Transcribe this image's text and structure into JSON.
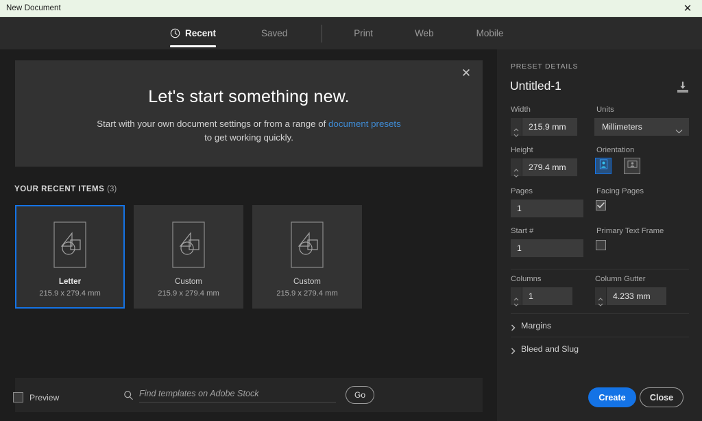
{
  "titlebar": {
    "title": "New Document",
    "close_icon": "close-icon"
  },
  "tabs": [
    {
      "label": "Recent",
      "icon": "clock-icon",
      "active": true
    },
    {
      "label": "Saved",
      "active": false
    },
    {
      "label": "Print",
      "active": false
    },
    {
      "label": "Web",
      "active": false
    },
    {
      "label": "Mobile",
      "active": false
    }
  ],
  "hero": {
    "title": "Let's start something new.",
    "line1_before": "Start with your own document settings or from a range of ",
    "link": "document presets",
    "line2": "to get working quickly.",
    "close_icon": "close-icon"
  },
  "recent": {
    "heading": "YOUR RECENT ITEMS",
    "count": "(3)",
    "items": [
      {
        "title": "Letter",
        "size": "215.9 x 279.4 mm",
        "selected": true
      },
      {
        "title": "Custom",
        "size": "215.9 x 279.4 mm",
        "selected": false
      },
      {
        "title": "Custom",
        "size": "215.9 x 279.4 mm",
        "selected": false
      }
    ]
  },
  "stock": {
    "placeholder": "Find templates on Adobe Stock",
    "value": "",
    "go_label": "Go",
    "search_icon": "search-icon"
  },
  "panel": {
    "section_label": "PRESET DETAILS",
    "preset_name": "Untitled-1",
    "save_icon": "save-preset-icon",
    "width": {
      "label": "Width",
      "value": "215.9 mm"
    },
    "units": {
      "label": "Units",
      "value": "Millimeters"
    },
    "height": {
      "label": "Height",
      "value": "279.4 mm"
    },
    "orientation": {
      "label": "Orientation",
      "portrait_active": true,
      "landscape_active": false
    },
    "pages": {
      "label": "Pages",
      "value": "1"
    },
    "facing_pages": {
      "label": "Facing Pages",
      "checked": true
    },
    "start": {
      "label": "Start #",
      "value": "1"
    },
    "primary_text_frame": {
      "label": "Primary Text Frame",
      "checked": false
    },
    "columns": {
      "label": "Columns",
      "value": "1"
    },
    "column_gutter": {
      "label": "Column Gutter",
      "value": "4.233 mm"
    },
    "margins": {
      "label": "Margins",
      "expanded": false
    },
    "bleed_and_slug": {
      "label": "Bleed and Slug",
      "expanded": false
    }
  },
  "footer": {
    "preview_label": "Preview",
    "preview_checked": false,
    "create_label": "Create",
    "close_label": "Close"
  },
  "colors": {
    "accent": "#1473e6",
    "link": "#3f8cd6",
    "titlebar_bg": "#eaf4e6",
    "panel_bg": "#252525",
    "main_bg": "#1d1d1d"
  }
}
